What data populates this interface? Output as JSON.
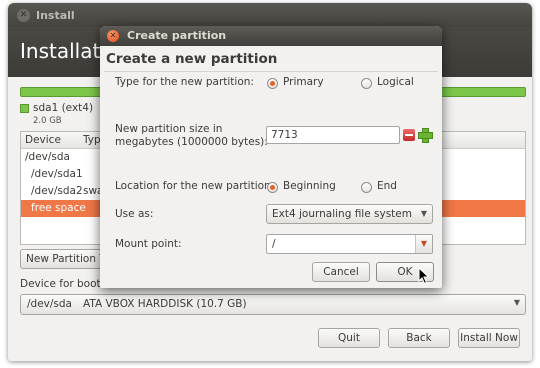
{
  "installer": {
    "window_title": "Install",
    "heading": "Installation type",
    "partition_legend": {
      "name": "sda1 (ext4)",
      "size": "2.0 GB",
      "color": "#7cc74a"
    },
    "table": {
      "columns": [
        "Device",
        "Type"
      ],
      "rows": [
        {
          "device": "/dev/sda",
          "type": ""
        },
        {
          "device": "/dev/sda1",
          "type": ""
        },
        {
          "device": "/dev/sda2",
          "type": "swap"
        },
        {
          "device": "free space",
          "type": "",
          "selected": true
        }
      ]
    },
    "new_partition_table_label": "New Partition Table...",
    "bootloader_label": "Device for boot loader installation:",
    "bootloader_device": "/dev/sda",
    "bootloader_desc": "ATA VBOX HARDDISK (10.7 GB)",
    "buttons": {
      "quit": "Quit",
      "back": "Back",
      "install_now": "Install Now"
    }
  },
  "dialog": {
    "title": "Create partition",
    "heading": "Create a new partition",
    "type_label": "Type for the new partition:",
    "type_options": [
      "Primary",
      "Logical"
    ],
    "type_selected": "Primary",
    "size_label_line1": "New partition size in",
    "size_label_line2": "megabytes (1000000 bytes):",
    "size_value": "7713",
    "location_label": "Location for the new partition:",
    "location_options": [
      "Beginning",
      "End"
    ],
    "location_selected": "Beginning",
    "use_as_label": "Use as:",
    "use_as_value": "Ext4 journaling file system",
    "mount_label": "Mount point:",
    "mount_value": "/",
    "cancel_label": "Cancel",
    "ok_label": "OK"
  },
  "colors": {
    "accent": "#f07746",
    "header_dark": "#3c3b37",
    "background": "#f2f1f0"
  },
  "icons": [
    "close-icon",
    "minus-icon",
    "plus-icon",
    "dropdown-arrow-icon",
    "mouse-cursor-icon"
  ]
}
